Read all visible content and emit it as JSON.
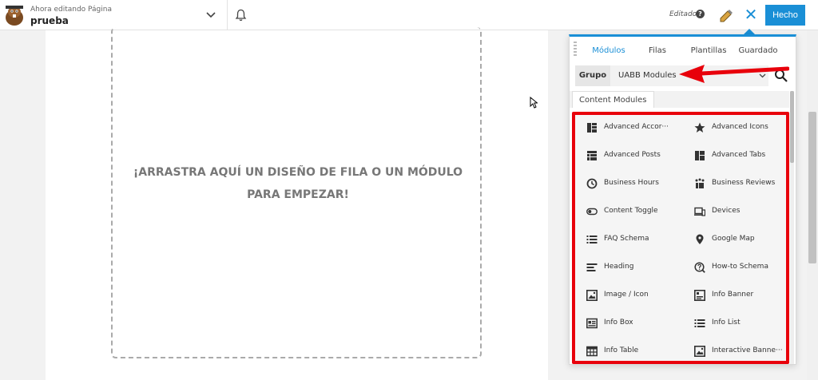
{
  "topbar": {
    "editing_label": "Ahora editando Página",
    "page_name": "prueba",
    "status": "Editado",
    "help_symbol": "?",
    "close_symbol": "✕",
    "done_label": "Hecho"
  },
  "canvas": {
    "drop_text": "¡ARRASTRA AQUÍ UN DISEÑO DE FILA O UN MÓDULO PARA EMPEZAR!"
  },
  "panel": {
    "tabs": [
      "Módulos",
      "Filas",
      "Plantillas",
      "Guardado"
    ],
    "active_tab": "Módulos",
    "group_label": "Grupo",
    "group_value": "UABB Modules",
    "content_tab": "Content Modules",
    "modules": [
      {
        "label": "Advanced Accor···",
        "icon": "accordion-icon"
      },
      {
        "label": "Advanced Icons",
        "icon": "star-icon"
      },
      {
        "label": "Advanced Posts",
        "icon": "posts-grid-icon"
      },
      {
        "label": "Advanced Tabs",
        "icon": "tabs-icon"
      },
      {
        "label": "Business Hours",
        "icon": "clock-icon"
      },
      {
        "label": "Business Reviews",
        "icon": "reviews-icon"
      },
      {
        "label": "Content Toggle",
        "icon": "toggle-icon"
      },
      {
        "label": "Devices",
        "icon": "devices-icon"
      },
      {
        "label": "FAQ Schema",
        "icon": "list-icon"
      },
      {
        "label": "Google Map",
        "icon": "map-pin-icon"
      },
      {
        "label": "Heading",
        "icon": "heading-icon"
      },
      {
        "label": "How-to Schema",
        "icon": "question-icon"
      },
      {
        "label": "Image / Icon",
        "icon": "image-icon"
      },
      {
        "label": "Info Banner",
        "icon": "banner-icon"
      },
      {
        "label": "Info Box",
        "icon": "info-box-icon"
      },
      {
        "label": "Info List",
        "icon": "list-icon"
      },
      {
        "label": "Info Table",
        "icon": "table-icon"
      },
      {
        "label": "Interactive Banne···",
        "icon": "image-icon"
      }
    ]
  },
  "colors": {
    "accent": "#1a8fd6",
    "highlight": "#e8000b"
  }
}
